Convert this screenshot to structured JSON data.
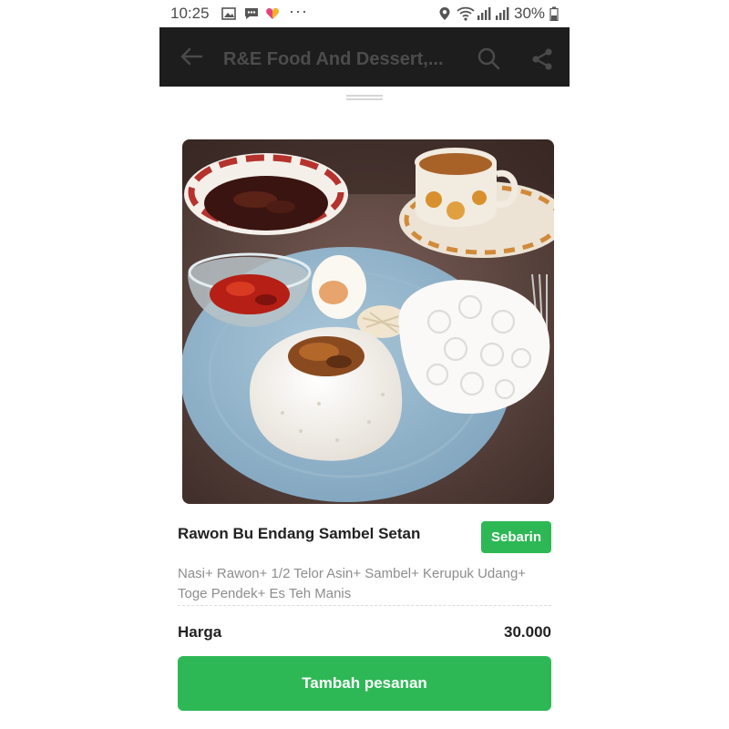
{
  "status_bar": {
    "time": "10:25",
    "battery": "30%",
    "overflow": "···",
    "icons": [
      "gallery-icon",
      "message-icon",
      "heart-app-icon",
      "location-icon",
      "wifi-icon",
      "signal-icon",
      "battery-icon"
    ]
  },
  "header": {
    "title": "R&E Food And Dessert,...",
    "icons": [
      "back-arrow-icon",
      "search-icon",
      "share-icon"
    ],
    "background": "#1d1d1d"
  },
  "item": {
    "name": "Rawon Bu Endang Sambel Setan",
    "share_label": "Sebarin",
    "description": "Nasi+ Rawon+ 1/2 Telor Asin+ Sambel+ Kerupuk Udang+ Toge Pendek+ Es Teh Manis",
    "price_label": "Harga",
    "price_value": "30.000"
  },
  "actions": {
    "order_label": "Tambah pesanan"
  },
  "colors": {
    "accent": "#2db855"
  }
}
